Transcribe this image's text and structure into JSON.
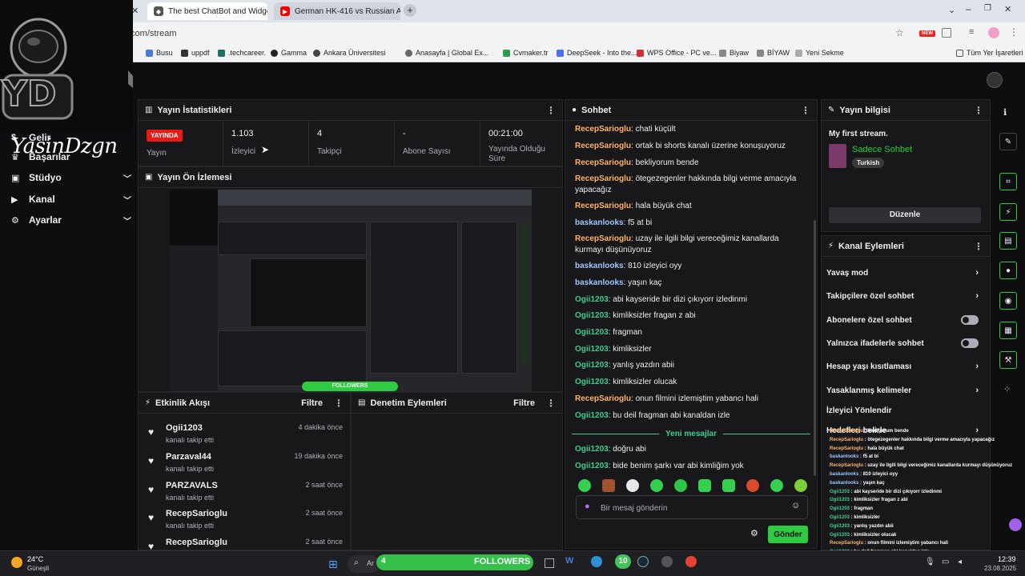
{
  "browser": {
    "tabs": [
      {
        "title": "The best ChatBot and Widgets"
      },
      {
        "title": "German HK-416 vs Russian AK"
      }
    ],
    "url": ".com/stream",
    "new_badge": "NEW",
    "bookmarks": [
      "Busu",
      "uppdf",
      ".techcareer.",
      "Gamma",
      "Ankara Üniversitesi",
      "Anasayfa | Global Ex...",
      "Cvmaker.tr",
      "DeepSeek - Into the...",
      "WPS Office - PC ve...",
      "Biyaw",
      "BİYAW",
      "Yeni Sekme"
    ],
    "bookmarks_all": "Tüm Yer İşaretleri"
  },
  "sidebar": {
    "logo_text": "YD",
    "brand_name": "YasinDzgn",
    "items": [
      {
        "label": "Gelir",
        "icon": "dollar-icon"
      },
      {
        "label": "Başarılar",
        "icon": "trophy-icon"
      },
      {
        "label": "Stüdyo",
        "icon": "studio-icon"
      },
      {
        "label": "Kanal",
        "icon": "channel-icon"
      },
      {
        "label": "Ayarlar",
        "icon": "gear-icon"
      }
    ]
  },
  "stats": {
    "title": "Yayın İstatistikleri",
    "badge": "YAYINDA",
    "badge_label": "Yayın",
    "viewers_value": "1.103",
    "viewers_label": "İzleyici",
    "followers_value": "4",
    "followers_label": "Takipçi",
    "subs_value": "-",
    "subs_label": "Abone Sayısı",
    "uptime_value": "00:21:00",
    "uptime_label": "Yayında Olduğu Süre"
  },
  "preview": {
    "title": "Yayın Ön İzlemesi",
    "overlay_text": "FOLLOWERS"
  },
  "activity": {
    "title": "Etkinlik Akışı",
    "filter": "Filtre",
    "items": [
      {
        "name": "Ogii1203",
        "action": "kanalı takip etti",
        "time": "4 dakika önce"
      },
      {
        "name": "Parzaval44",
        "action": "kanalı takip etti",
        "time": "19 dakika önce"
      },
      {
        "name": "PARZAVALS",
        "action": "kanalı takip etti",
        "time": "2 saat önce"
      },
      {
        "name": "RecepSarioglu",
        "action": "kanalı takip etti",
        "time": "2 saat önce"
      },
      {
        "name": "RecepSarioglu",
        "action": "",
        "time": "2 saat önce"
      }
    ]
  },
  "moderation": {
    "title": "Denetim Eylemleri",
    "filter": "Filtre"
  },
  "chat": {
    "title": "Sohbet",
    "messages": [
      {
        "user": "RecepSarioglu",
        "text": "chati küçült",
        "kind": "recep"
      },
      {
        "user": "RecepSarioglu",
        "text": "ortak bi shorts kanalı üzerine konuşuyoruz",
        "kind": "recep"
      },
      {
        "user": "RecepSarioglu",
        "text": "bekliyorum bende",
        "kind": "recep"
      },
      {
        "user": "RecepSarioglu",
        "text": "ötegezegenler hakkında bilgi verme amacıyla yapacağız",
        "kind": "recep"
      },
      {
        "user": "RecepSarioglu",
        "text": "hala büyük chat",
        "kind": "recep"
      },
      {
        "user": "baskanlooks",
        "text": "f5 at bi",
        "kind": "bask"
      },
      {
        "user": "RecepSarioglu",
        "text": "uzay ile ilgili bilgi vereceğimiz kanallarda kurmayı düşünüyoruz",
        "kind": "recep"
      },
      {
        "user": "baskanlooks",
        "text": "810 izleyici oyy",
        "kind": "bask"
      },
      {
        "user": "baskanlooks",
        "text": "yaşın kaç",
        "kind": "bask"
      },
      {
        "user": "Ogii1203",
        "text": "abi kayseride bir dizi çıkıyorr izledinmi",
        "kind": "ogii"
      },
      {
        "user": "Ogii1203",
        "text": "kimliksizler fragan z abi",
        "kind": "ogii"
      },
      {
        "user": "Ogii1203",
        "text": "fragman",
        "kind": "ogii"
      },
      {
        "user": "Ogii1203",
        "text": "kimliksizler",
        "kind": "ogii"
      },
      {
        "user": "Ogii1203",
        "text": "yanlış yazdın abii",
        "kind": "ogii"
      },
      {
        "user": "Ogii1203",
        "text": "kimliksizler olucak",
        "kind": "ogii"
      },
      {
        "user": "RecepSarioglu",
        "text": "onun filmini izlemiştim yabancı hali",
        "kind": "recep"
      },
      {
        "user": "Ogii1203",
        "text": "bu deil fragman abi kanaldan izle",
        "kind": "ogii"
      },
      {
        "user": "Ogii1203",
        "text": "doğru abi",
        "kind": "ogii"
      },
      {
        "user": "Ogii1203",
        "text": "bide benim şarkı var abi kimliğim yok",
        "kind": "ogii"
      }
    ],
    "new_messages": "Yeni mesajlar",
    "input_placeholder": "Bir mesaj gönderin",
    "send_label": "Gönder"
  },
  "stream_info": {
    "title": "Yayın bilgisi",
    "stream_title": "My first stream.",
    "category": "Sadece Sohbet",
    "tag": "Turkish",
    "edit_label": "Düzenle"
  },
  "channel_actions": {
    "title": "Kanal Eylemleri",
    "items": [
      {
        "label": "Yavaş mod",
        "control": "chevron"
      },
      {
        "label": "Takipçilere özel sohbet",
        "control": "chevron"
      },
      {
        "label": "Abonelere özel sohbet",
        "control": "toggle"
      },
      {
        "label": "Yalnızca ifadelerle sohbet",
        "control": "toggle"
      },
      {
        "label": "Hesap yaşı kısıtlaması",
        "control": "chevron"
      },
      {
        "label": "Yasaklanmış kelimeler",
        "control": "chevron"
      },
      {
        "label": "İzleyici Yönlendir",
        "control": "none"
      },
      {
        "label": "Hedefleri belirle",
        "control": "chevron"
      }
    ]
  },
  "overlay_chat": [
    {
      "user": "RecepSarioglu",
      "text": "bekliyorum bende",
      "kind": "recep"
    },
    {
      "user": "RecepSarioglu",
      "text": "ötegezegenler hakkında bilgi verme amacıyla yapacağız",
      "kind": "recep"
    },
    {
      "user": "RecepSarioglu",
      "text": "hala büyük chat",
      "kind": "recep"
    },
    {
      "user": "baskanlooks",
      "text": "f5 at bi",
      "kind": "bask"
    },
    {
      "user": "RecepSarioglu",
      "text": "uzay ile ilgili bilgi vereceğimiz kanallarda kurmayı düşünüyoruz",
      "kind": "recep"
    },
    {
      "user": "baskanlooks",
      "text": "810 izleyici oyy",
      "kind": "bask"
    },
    {
      "user": "baskanlooks",
      "text": "yaşın kaç",
      "kind": "bask"
    },
    {
      "user": "Ogii1203",
      "text": "abi kayseride bir dizi çıkıyorr izledinmi",
      "kind": "ogii"
    },
    {
      "user": "Ogii1203",
      "text": "kimliksizler fragan z abi",
      "kind": "ogii"
    },
    {
      "user": "Ogii1203",
      "text": "fragman",
      "kind": "ogii"
    },
    {
      "user": "Ogii1203",
      "text": "kimliksizler",
      "kind": "ogii"
    },
    {
      "user": "Ogii1203",
      "text": "yanlış yazdın abii",
      "kind": "ogii"
    },
    {
      "user": "Ogii1203",
      "text": "kimliksizler olucak",
      "kind": "ogii"
    },
    {
      "user": "RecepSarioglu",
      "text": "onun filmini izlemiştim yabancı hali",
      "kind": "recep"
    },
    {
      "user": "Ogii1203",
      "text": "bu deil fragman abi kanaldan izle",
      "kind": "ogii"
    },
    {
      "user": "Ogii1203",
      "text": "doğru abi",
      "kind": "ogii"
    },
    {
      "user": "Ogii1203",
      "text": "bide benim şarkı var abi kimliğim yok",
      "kind": "ogii"
    }
  ],
  "taskbar": {
    "weather_temp": "24°C",
    "weather_desc": "Güneşli",
    "search_text": "Ar",
    "followers_count": "4",
    "followers_label": "FOLLOWERS",
    "progress_count": "10",
    "time": "12:39",
    "date": "23.08.2025"
  },
  "colors": {
    "accent": "#2ecc40",
    "live": "#e91916",
    "recep": "#ffb36b",
    "bask": "#9fc7ff",
    "ogii": "#3ecf8e"
  }
}
